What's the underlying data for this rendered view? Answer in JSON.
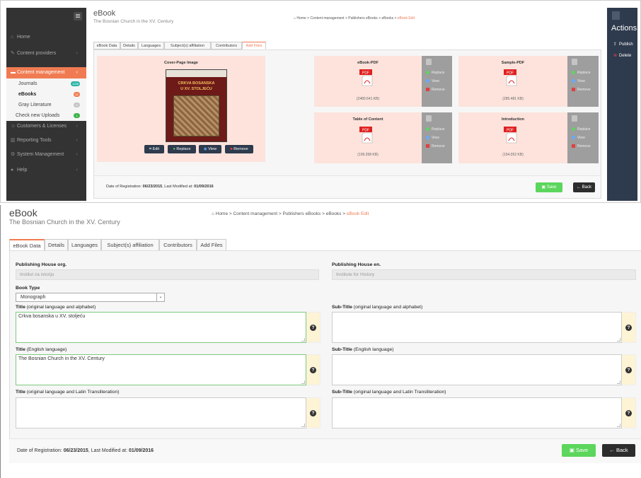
{
  "shot1": {
    "title": "eBook",
    "subtitle": "The Bosnian Church in the XV. Century",
    "breadcrumb": {
      "home": "Home",
      "sep": ">",
      "items": [
        "Content management",
        "Publishers eBooks",
        "eBooks"
      ],
      "current": "eBook Edit"
    },
    "tabs": [
      "eBook Data",
      "Details",
      "Languages",
      "Subject(s) affiliation",
      "Contributors",
      "Add Files"
    ],
    "active_tab": "Add Files",
    "sidebar": {
      "items": [
        {
          "icon": "home-icon",
          "label": "Home"
        },
        {
          "icon": "edit-icon",
          "label": "Content providers"
        },
        {
          "icon": "folder-icon",
          "label": "Content management"
        }
      ],
      "sub_items": [
        {
          "label": "Journals",
          "badge": "1236",
          "badge_color": "#2ab4a6"
        },
        {
          "label": "eBooks",
          "badge": "32",
          "badge_color": "#f07b52"
        },
        {
          "label": "Gray Literature",
          "badge": "0",
          "badge_color": "#c6c6c6"
        },
        {
          "label": "Check new Uploads",
          "badge": "1",
          "badge_color": "#3cb44b"
        }
      ],
      "items2": [
        {
          "icon": "users-icon",
          "label": "Customers & Licenses"
        },
        {
          "icon": "chart-icon",
          "label": "Reporting Tools"
        },
        {
          "icon": "gear-icon",
          "label": "System Management"
        },
        {
          "icon": "help-icon",
          "label": "Help"
        }
      ]
    },
    "actions": {
      "title": "Actions",
      "publish": "Publish",
      "delete": "Delete"
    },
    "cover": {
      "title": "Cover-Page Image",
      "book_text1": "CRKVA BOSANSKA",
      "book_text2": "U XV. STOLJEĆU",
      "buttons": {
        "edit": "Edit",
        "replace": "Replace",
        "view": "View",
        "remove": "Remove"
      }
    },
    "files": [
      {
        "title": "eBook-PDF",
        "size": "(2480.641 KB)"
      },
      {
        "title": "Sample-PDF",
        "size": "(285.481 KB)"
      },
      {
        "title": "Table of Content",
        "size": "(109.358 KB)"
      },
      {
        "title": "Introduction",
        "size": "(154.052 KB)"
      }
    ],
    "file_actions": {
      "replace": "Replace",
      "view": "View",
      "remove": "Remove"
    },
    "pdf_label": "PDF",
    "footer": {
      "reg_label": "Date of Registration:",
      "reg_date": "06/23/2015",
      "mod_label": ", Last Modified at:",
      "mod_date": "01/09/2016"
    },
    "save": "Save",
    "back": "Back"
  },
  "shot2": {
    "title": "eBook",
    "subtitle": "The Bosnian Church in the XV. Century",
    "breadcrumb": {
      "home": "Home",
      "sep": ">",
      "items": [
        "Content management",
        "Publishers eBooks",
        "eBooks"
      ],
      "current": "eBook Edit"
    },
    "tabs": [
      "eBook Data",
      "Details",
      "Languages",
      "Subject(s) affiliation",
      "Contributors",
      "Add Files"
    ],
    "active_tab": "eBook Data",
    "ph_org_label": "Publishing House org.",
    "ph_org_value": "Institut za istoriju",
    "ph_en_label": "Publishing House en.",
    "ph_en_value": "Institute for History",
    "book_type_label": "Book Type",
    "book_type_value": "Monograph",
    "title_label_bold": "Title",
    "subtitle_label_bold": "Sub-Title",
    "q1": " (original language and alphabet)",
    "q2": " (English language)",
    "q3": " (original language and Latin Transliteration)",
    "title_orig": "Crkva bosanska u XV. stoljeću",
    "title_en": "The Bosnian Church in the XV. Century",
    "title_latin": "",
    "sub_orig": "",
    "sub_en": "",
    "sub_latin": "",
    "help_glyph": "?",
    "footer": {
      "reg_label": "Date of Registration:",
      "reg_date": "06/23/2015",
      "mod_label": ", Last Modified at:",
      "mod_date": "01/09/2016"
    },
    "save": "Save",
    "back": "Back"
  }
}
